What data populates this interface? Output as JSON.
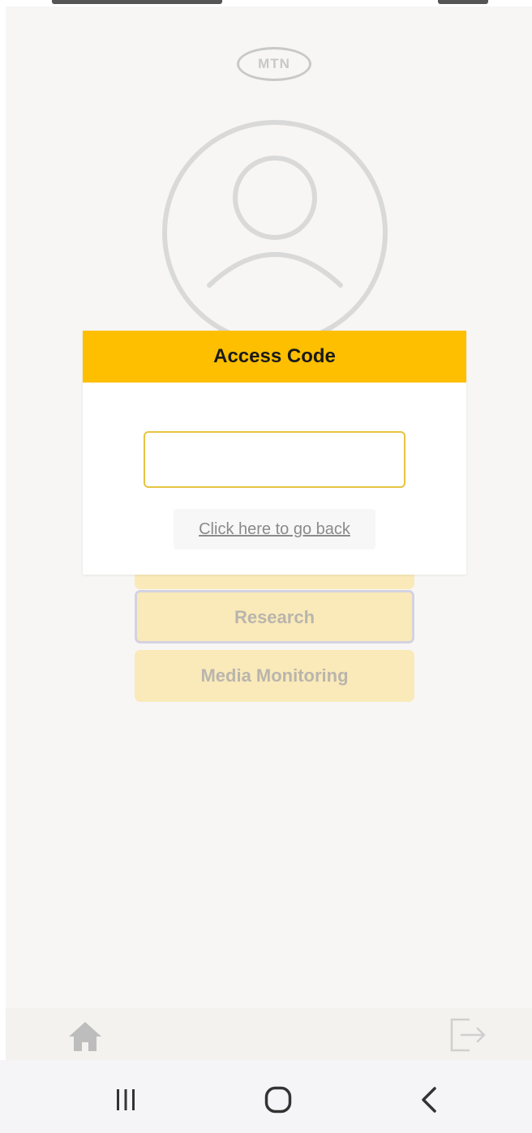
{
  "brand": {
    "logo_text": "MTN",
    "accent_color": "#fdbf00"
  },
  "menu": {
    "items": [
      {
        "label": ""
      },
      {
        "label": "Research"
      },
      {
        "label": "Media Monitoring"
      }
    ]
  },
  "bottom_nav": {
    "left_icon": "home-icon",
    "right_icon": "logout-icon"
  },
  "dialog": {
    "title": "Access Code",
    "input_value": "",
    "back_link": "Click here to go back"
  },
  "system_nav": {
    "icons": [
      "recent-apps-icon",
      "home-circle-icon",
      "back-chevron-icon"
    ]
  }
}
